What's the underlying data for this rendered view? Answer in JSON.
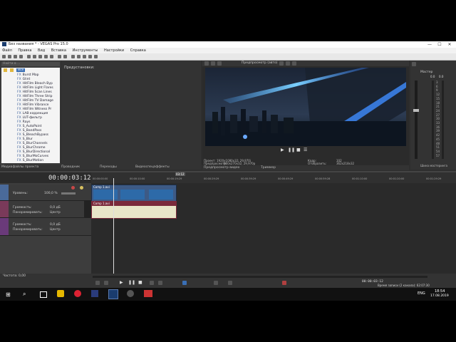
{
  "window": {
    "title": "Без названия * - VEGAS Pro 15.0",
    "min": "—",
    "max": "☐",
    "close": "✕"
  },
  "menu": [
    "Файл",
    "Правка",
    "Вид",
    "Вставка",
    "Инструменты",
    "Настройки",
    "Справка"
  ],
  "explorer": {
    "search_placeholder": "Найти в ...",
    "root": "Все",
    "items": [
      "Burst Map",
      "Glint",
      "HitFilm Bleach Byp",
      "HitFilm Light Flares",
      "HitFilm Scan Lines",
      "HitFilm Three Strip",
      "HitFilm TV Damage",
      "HitFilm Vibrance",
      "HitFilm Witness Pr",
      "LAB коррекция",
      "LUT-фильтр",
      "Rays",
      "S_AutoPaint",
      "S_BandPass",
      "S_BleachBypass",
      "S_Blur",
      "S_BlurChannels",
      "S_BlurChrome",
      "S_BlurDirectional",
      "S_BlurMoCurves",
      "S_BlurMotion"
    ],
    "presets_label": "Предустановки:"
  },
  "left_tabs": [
    "Медиафайлы проекта",
    "Проводник",
    "Переходы",
    "Видеоспецэффекты"
  ],
  "preview": {
    "mode": "Предпросмотр (авто)",
    "project_label": "Проект:",
    "project_value": "1920x1080x32; 29,970i",
    "preview_label": "Предпросмотр:",
    "preview_value": "960x270x32; 29,970p",
    "video_label": "Видео:",
    "frame_label": "Кадр:",
    "frame_value": "102",
    "display_label": "Отобразить:",
    "display_value": "362x218x32",
    "tab_video": "Предпросмотр видео",
    "tab_trimmer": "Триммер"
  },
  "master": {
    "label": "Мастер",
    "peak_left": "0.0",
    "peak_right": "0.0",
    "bottom_tab": "Шина мастеринга",
    "scale": [
      "3",
      "6",
      "9",
      "12",
      "15",
      "18",
      "21",
      "24",
      "27",
      "30",
      "33",
      "36",
      "39",
      "42",
      "45",
      "48",
      "51",
      "54",
      "57"
    ]
  },
  "timeline": {
    "timecode": "00:00:03:12",
    "marker_label": "03:12",
    "ruler": [
      "00:00:00:00",
      "00:00:10:00",
      "00:00:19:29",
      "00:00:29:29",
      "00:00:39:29",
      "00:00:49:29",
      "00:00:59:28",
      "00:01:10:00",
      "00:01:20:00",
      "00:01:29:29"
    ],
    "track1": {
      "level_label": "Уровень:",
      "level_value": "100,0 %",
      "clip_name": "Comp 1.avi"
    },
    "track2": {
      "vol_label": "Громкость:",
      "vol_value": "0,0 дБ",
      "pan_label": "Панорамировать:",
      "pan_value": "Центр",
      "clip_name": "Comp 1.avi"
    },
    "track3": {
      "vol_label": "Громкость:",
      "vol_value": "0,0 дБ",
      "pan_label": "Панорамировать:",
      "pan_value": "Центр"
    },
    "rate_label": "Частота: 0,00",
    "cursor_time": "00:00:03:12",
    "status": "Время записи (2 канала): 62:07:30"
  },
  "taskbar": {
    "time": "18:54",
    "date": "17.08.2019",
    "lang": "ENG"
  }
}
